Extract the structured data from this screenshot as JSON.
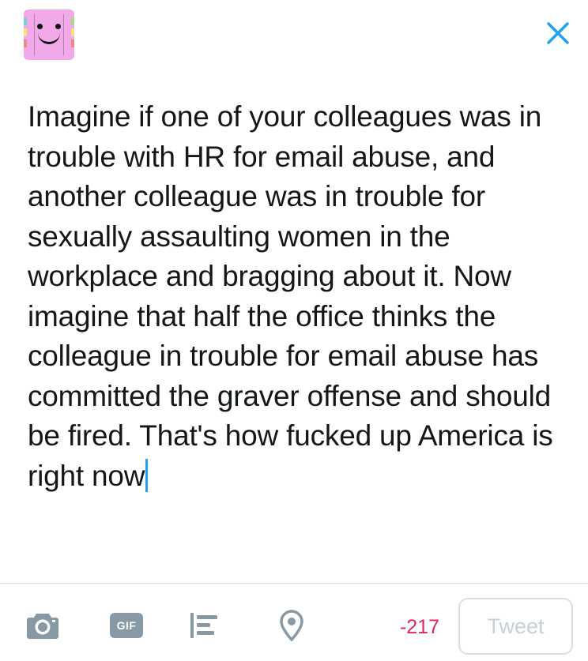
{
  "compose": {
    "text": "Imagine if one of your colleagues was in trouble with HR for email abuse, and another colleague was in trouble for sexually assaulting women in the workplace and bragging about it. Now imagine that half the office thinks the colleague in trouble for email abuse has committed the graver offense and should be fired. That's how fucked up America is right now"
  },
  "toolbar": {
    "gif_label": "GIF",
    "char_count": "-217",
    "tweet_label": "Tweet"
  },
  "icons": {
    "close": "close-icon",
    "camera": "camera-icon",
    "gif": "gif-icon",
    "poll": "poll-icon",
    "location": "location-pin-icon"
  },
  "colors": {
    "accent": "#1da1f2",
    "icon": "#8899a6",
    "over_limit": "#e0245e",
    "disabled_text": "#c5d0d8",
    "avatar_bg": "#f1a9e9"
  }
}
